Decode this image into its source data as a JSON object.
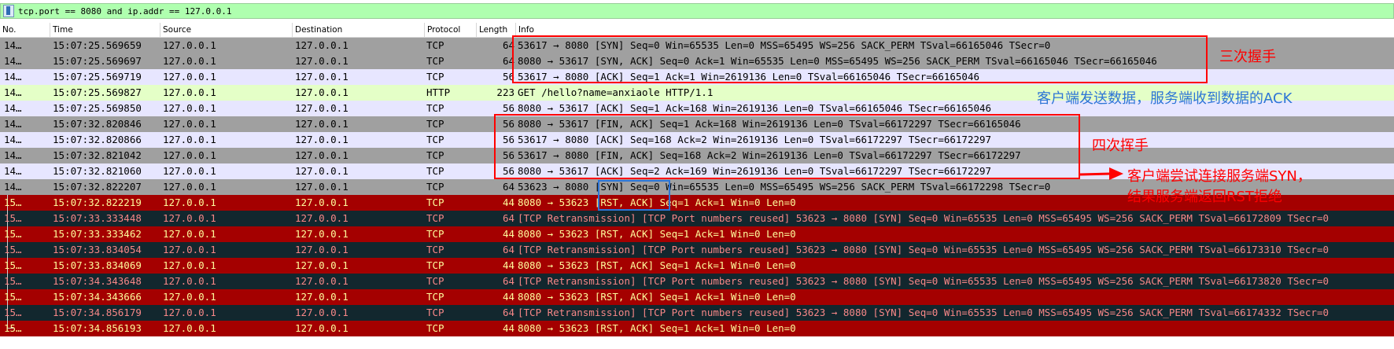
{
  "filter": {
    "expression": "tcp.port == 8080 and ip.addr == 127.0.0.1"
  },
  "columns": {
    "no": "No.",
    "time": "Time",
    "source": "Source",
    "destination": "Destination",
    "protocol": "Protocol",
    "length": "Length",
    "info": "Info"
  },
  "colors": {
    "gray": "#a0a0a0",
    "lightblue": "#e7e6ff",
    "green": "#e4ffc7",
    "darkred": "#a40000",
    "darkslate": "#12272e",
    "fg_dark": "#000000",
    "fg_red": "#fffc9c",
    "fg_slate": "#f78787",
    "annotation_red": "#ff0000",
    "annotation_blue": "#2e75d6"
  },
  "packets": [
    {
      "no": "14…",
      "time": "15:07:25.569659",
      "source": "127.0.0.1",
      "destination": "127.0.0.1",
      "protocol": "TCP",
      "length": "64",
      "info": "53617 → 8080 [SYN] Seq=0 Win=65535 Len=0 MSS=65495 WS=256 SACK_PERM TSval=66165046 TSecr=0",
      "style": "gray"
    },
    {
      "no": "14…",
      "time": "15:07:25.569697",
      "source": "127.0.0.1",
      "destination": "127.0.0.1",
      "protocol": "TCP",
      "length": "64",
      "info": "8080 → 53617 [SYN, ACK] Seq=0 Ack=1 Win=65535 Len=0 MSS=65495 WS=256 SACK_PERM TSval=66165046 TSecr=66165046",
      "style": "gray"
    },
    {
      "no": "14…",
      "time": "15:07:25.569719",
      "source": "127.0.0.1",
      "destination": "127.0.0.1",
      "protocol": "TCP",
      "length": "56",
      "info": "53617 → 8080 [ACK] Seq=1 Ack=1 Win=2619136 Len=0 TSval=66165046 TSecr=66165046",
      "style": "lightblue"
    },
    {
      "no": "14…",
      "time": "15:07:25.569827",
      "source": "127.0.0.1",
      "destination": "127.0.0.1",
      "protocol": "HTTP",
      "length": "223",
      "info": "GET /hello?name=anxiaole HTTP/1.1",
      "style": "green"
    },
    {
      "no": "14…",
      "time": "15:07:25.569850",
      "source": "127.0.0.1",
      "destination": "127.0.0.1",
      "protocol": "TCP",
      "length": "56",
      "info": "8080 → 53617 [ACK] Seq=1 Ack=168 Win=2619136 Len=0 TSval=66165046 TSecr=66165046",
      "style": "lightblue"
    },
    {
      "no": "14…",
      "time": "15:07:32.820846",
      "source": "127.0.0.1",
      "destination": "127.0.0.1",
      "protocol": "TCP",
      "length": "56",
      "info": "8080 → 53617 [FIN, ACK] Seq=1 Ack=168 Win=2619136 Len=0 TSval=66172297 TSecr=66165046",
      "style": "gray"
    },
    {
      "no": "14…",
      "time": "15:07:32.820866",
      "source": "127.0.0.1",
      "destination": "127.0.0.1",
      "protocol": "TCP",
      "length": "56",
      "info": "53617 → 8080 [ACK] Seq=168 Ack=2 Win=2619136 Len=0 TSval=66172297 TSecr=66172297",
      "style": "lightblue"
    },
    {
      "no": "14…",
      "time": "15:07:32.821042",
      "source": "127.0.0.1",
      "destination": "127.0.0.1",
      "protocol": "TCP",
      "length": "56",
      "info": "53617 → 8080 [FIN, ACK] Seq=168 Ack=2 Win=2619136 Len=0 TSval=66172297 TSecr=66172297",
      "style": "gray"
    },
    {
      "no": "14…",
      "time": "15:07:32.821060",
      "source": "127.0.0.1",
      "destination": "127.0.0.1",
      "protocol": "TCP",
      "length": "56",
      "info": "8080 → 53617 [ACK] Seq=2 Ack=169 Win=2619136 Len=0 TSval=66172297 TSecr=66172297",
      "style": "lightblue"
    },
    {
      "no": "14…",
      "time": "15:07:32.822207",
      "source": "127.0.0.1",
      "destination": "127.0.0.1",
      "protocol": "TCP",
      "length": "64",
      "info": "53623 → 8080 [SYN] Seq=0 Win=65535 Len=0 MSS=65495 WS=256 SACK_PERM TSval=66172298 TSecr=0",
      "style": "gray"
    },
    {
      "no": "15…",
      "time": "15:07:32.822219",
      "source": "127.0.0.1",
      "destination": "127.0.0.1",
      "protocol": "TCP",
      "length": "44",
      "info": "8080 → 53623 [RST, ACK] Seq=1 Ack=1 Win=0 Len=0",
      "style": "darkred"
    },
    {
      "no": "15…",
      "time": "15:07:33.333448",
      "source": "127.0.0.1",
      "destination": "127.0.0.1",
      "protocol": "TCP",
      "length": "64",
      "info": "[TCP Retransmission] [TCP Port numbers reused] 53623 → 8080 [SYN] Seq=0 Win=65535 Len=0 MSS=65495 WS=256 SACK_PERM TSval=66172809 TSecr=0",
      "style": "darkslate"
    },
    {
      "no": "15…",
      "time": "15:07:33.333462",
      "source": "127.0.0.1",
      "destination": "127.0.0.1",
      "protocol": "TCP",
      "length": "44",
      "info": "8080 → 53623 [RST, ACK] Seq=1 Ack=1 Win=0 Len=0",
      "style": "darkred"
    },
    {
      "no": "15…",
      "time": "15:07:33.834054",
      "source": "127.0.0.1",
      "destination": "127.0.0.1",
      "protocol": "TCP",
      "length": "64",
      "info": "[TCP Retransmission] [TCP Port numbers reused] 53623 → 8080 [SYN] Seq=0 Win=65535 Len=0 MSS=65495 WS=256 SACK_PERM TSval=66173310 TSecr=0",
      "style": "darkslate"
    },
    {
      "no": "15…",
      "time": "15:07:33.834069",
      "source": "127.0.0.1",
      "destination": "127.0.0.1",
      "protocol": "TCP",
      "length": "44",
      "info": "8080 → 53623 [RST, ACK] Seq=1 Ack=1 Win=0 Len=0",
      "style": "darkred"
    },
    {
      "no": "15…",
      "time": "15:07:34.343648",
      "source": "127.0.0.1",
      "destination": "127.0.0.1",
      "protocol": "TCP",
      "length": "64",
      "info": "[TCP Retransmission] [TCP Port numbers reused] 53623 → 8080 [SYN] Seq=0 Win=65535 Len=0 MSS=65495 WS=256 SACK_PERM TSval=66173820 TSecr=0",
      "style": "darkslate"
    },
    {
      "no": "15…",
      "time": "15:07:34.343666",
      "source": "127.0.0.1",
      "destination": "127.0.0.1",
      "protocol": "TCP",
      "length": "44",
      "info": "8080 → 53623 [RST, ACK] Seq=1 Ack=1 Win=0 Len=0",
      "style": "darkred"
    },
    {
      "no": "15…",
      "time": "15:07:34.856179",
      "source": "127.0.0.1",
      "destination": "127.0.0.1",
      "protocol": "TCP",
      "length": "64",
      "info": "[TCP Retransmission] [TCP Port numbers reused] 53623 → 8080 [SYN] Seq=0 Win=65535 Len=0 MSS=65495 WS=256 SACK_PERM TSval=66174332 TSecr=0",
      "style": "darkslate"
    },
    {
      "no": "15…",
      "time": "15:07:34.856193",
      "source": "127.0.0.1",
      "destination": "127.0.0.1",
      "protocol": "TCP",
      "length": "44",
      "info": "8080 → 53623 [RST, ACK] Seq=1 Ack=1 Win=0 Len=0",
      "style": "darkred"
    }
  ],
  "annotations": {
    "handshake": "三次握手",
    "data_ack": "客户端发送数据，服务端收到数据的ACK",
    "wave": "四次挥手",
    "rst_line1": "客户端尝试连接服务端SYN，",
    "rst_line2": "结果服务端返回RST拒绝"
  }
}
